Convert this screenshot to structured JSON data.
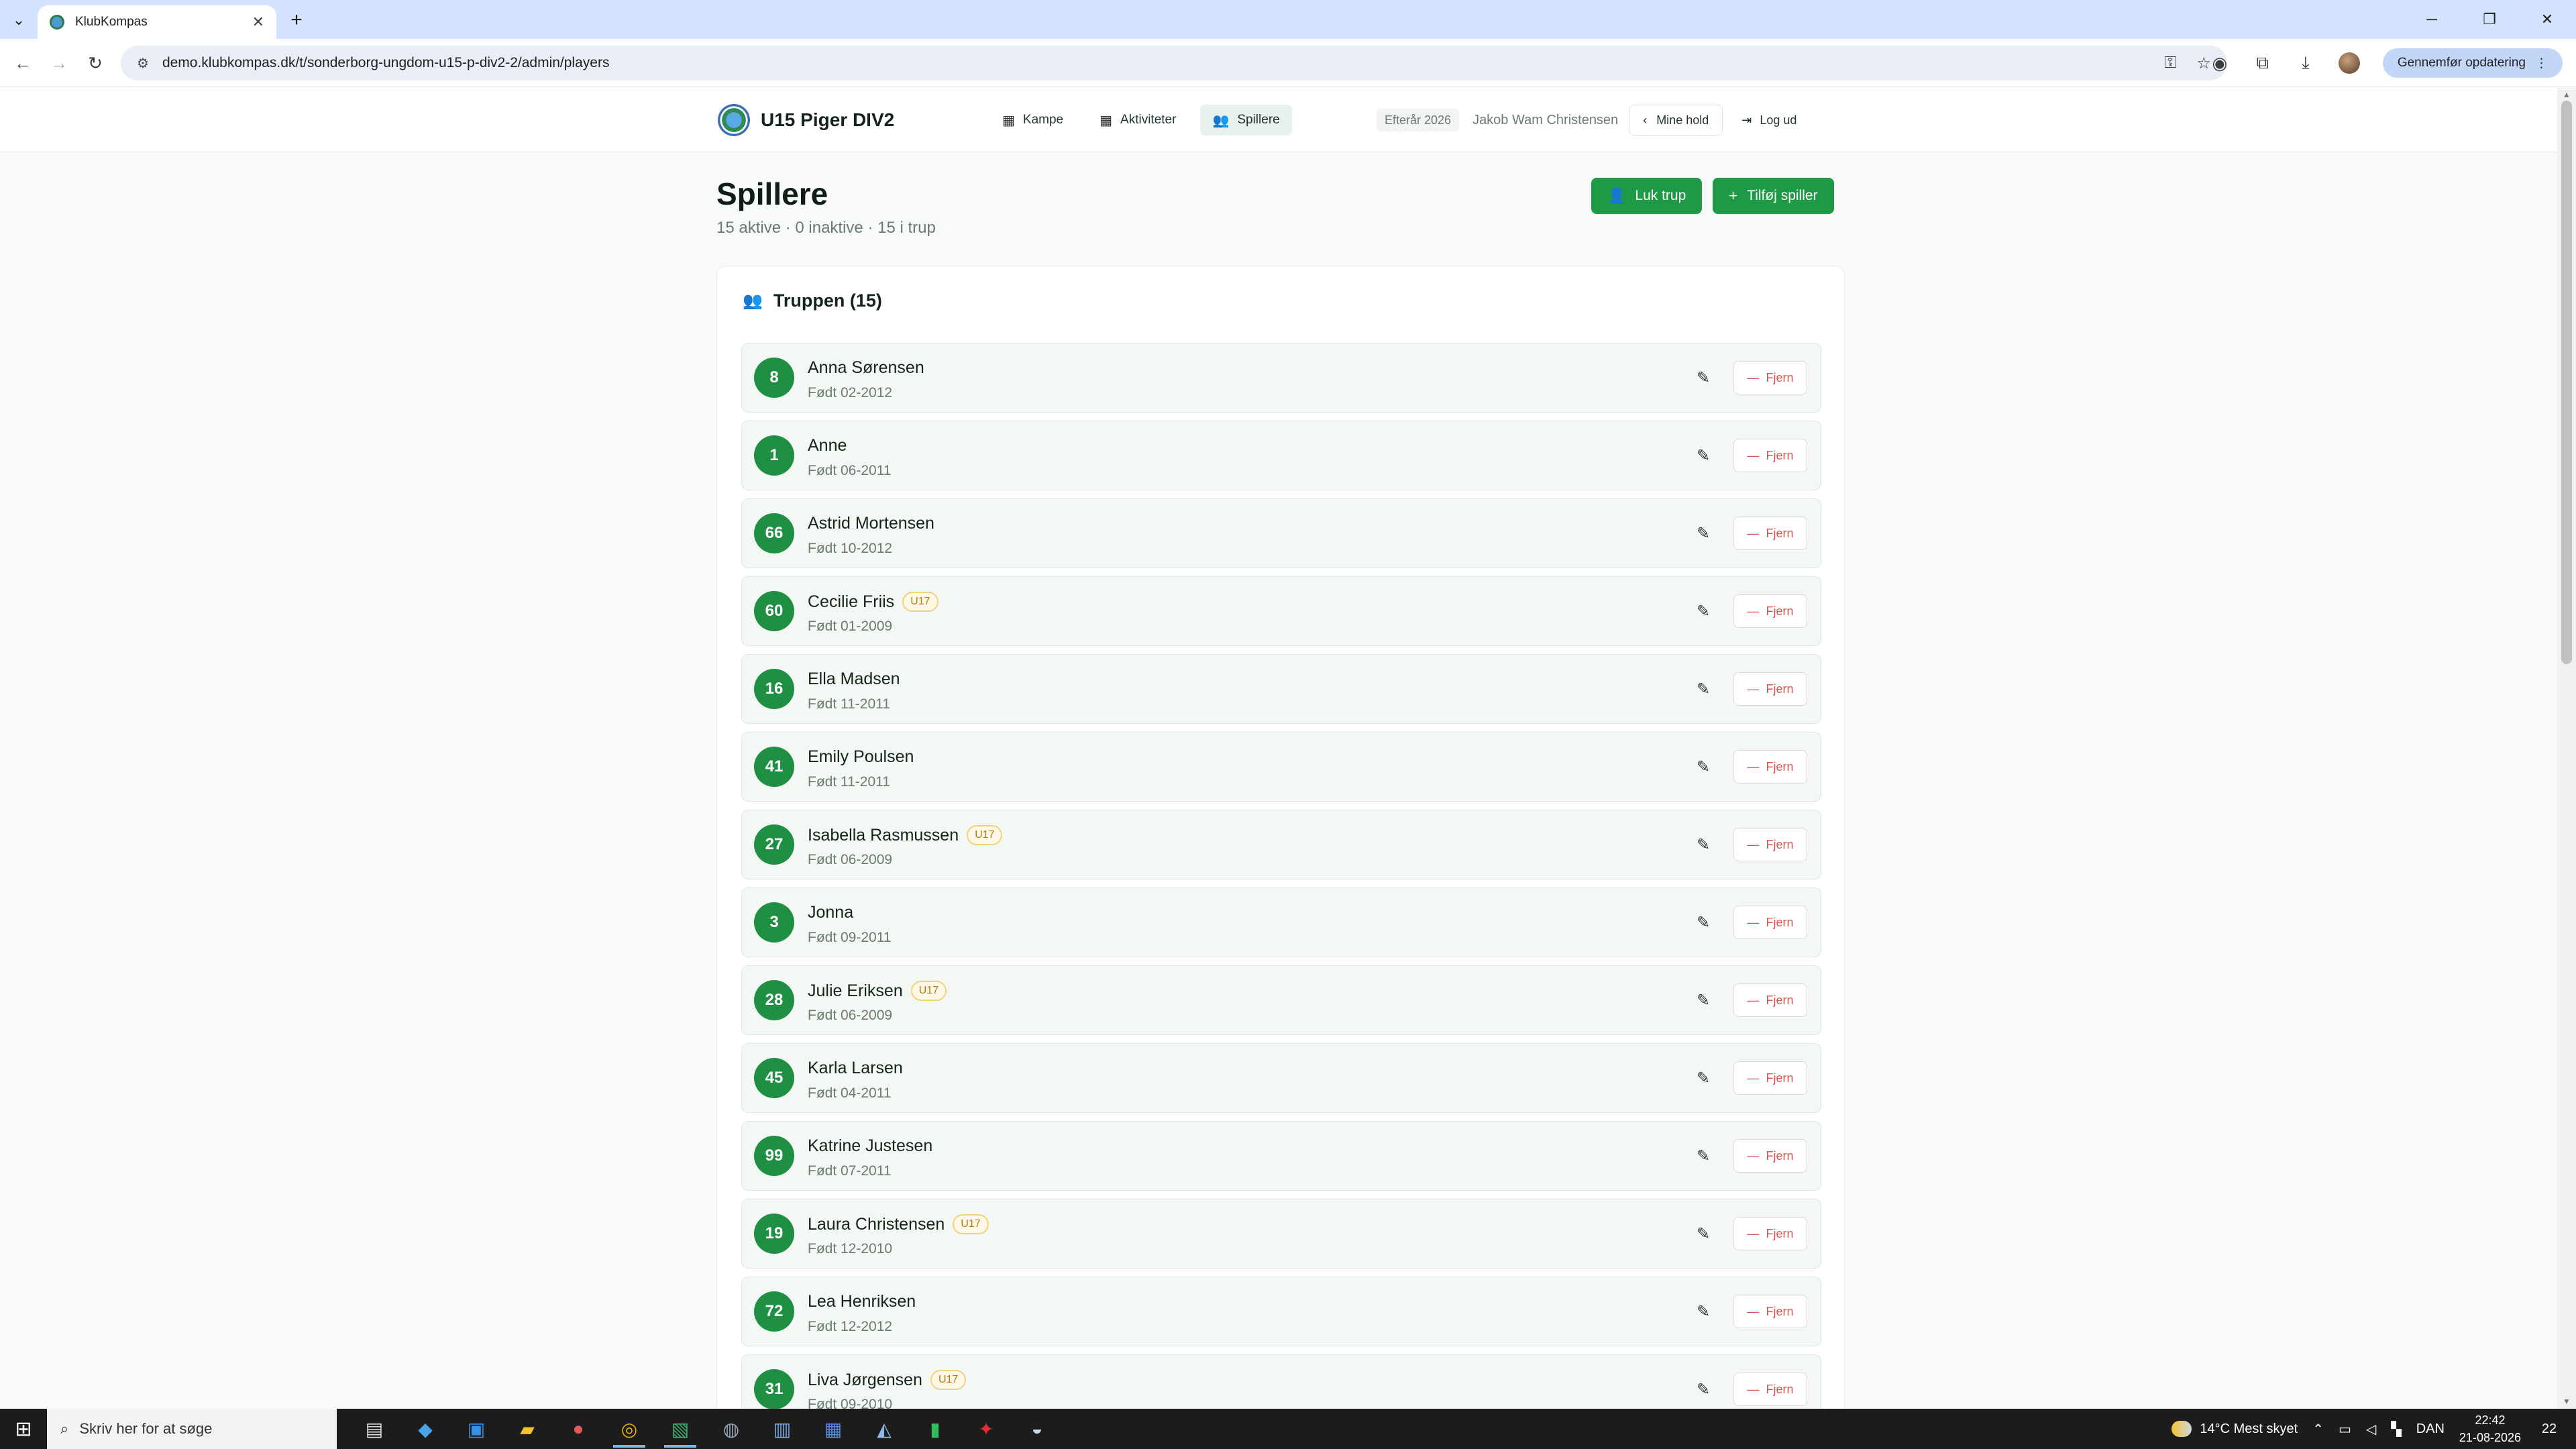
{
  "browser": {
    "tab_title": "KlubKompas",
    "url": "demo.klubkompas.dk/t/sonderborg-ungdom-u15-p-div2-2/admin/players",
    "update_label": "Gennemfør opdatering"
  },
  "header": {
    "team_name": "U15 Piger DIV2",
    "nav": [
      {
        "label": "Kampe",
        "icon": "calendar-icon"
      },
      {
        "label": "Aktiviteter",
        "icon": "calendar-icon"
      },
      {
        "label": "Spillere",
        "icon": "users-icon",
        "active": true
      }
    ],
    "season": "Efterår 2026",
    "user": "Jakob Wam Christensen",
    "mine_hold": "Mine hold",
    "logout": "Log ud"
  },
  "page": {
    "title": "Spillere",
    "subtitle": "15 aktive · 0 inaktive · 15 i trup",
    "close_squad_label": "Luk trup",
    "add_player_label": "Tilføj spiller",
    "card_title": "Truppen (15)",
    "remove_label": "Fjern"
  },
  "players": [
    {
      "number": "8",
      "name": "Anna Sørensen",
      "born": "Født 02-2012",
      "badge": ""
    },
    {
      "number": "1",
      "name": "Anne",
      "born": "Født 06-2011",
      "badge": ""
    },
    {
      "number": "66",
      "name": "Astrid Mortensen",
      "born": "Født 10-2012",
      "badge": ""
    },
    {
      "number": "60",
      "name": "Cecilie Friis",
      "born": "Født 01-2009",
      "badge": "U17"
    },
    {
      "number": "16",
      "name": "Ella Madsen",
      "born": "Født 11-2011",
      "badge": ""
    },
    {
      "number": "41",
      "name": "Emily Poulsen",
      "born": "Født 11-2011",
      "badge": ""
    },
    {
      "number": "27",
      "name": "Isabella Rasmussen",
      "born": "Født 06-2009",
      "badge": "U17"
    },
    {
      "number": "3",
      "name": "Jonna",
      "born": "Født 09-2011",
      "badge": ""
    },
    {
      "number": "28",
      "name": "Julie Eriksen",
      "born": "Født 06-2009",
      "badge": "U17"
    },
    {
      "number": "45",
      "name": "Karla Larsen",
      "born": "Født 04-2011",
      "badge": ""
    },
    {
      "number": "99",
      "name": "Katrine Justesen",
      "born": "Født 07-2011",
      "badge": ""
    },
    {
      "number": "19",
      "name": "Laura Christensen",
      "born": "Født 12-2010",
      "badge": "U17"
    },
    {
      "number": "72",
      "name": "Lea Henriksen",
      "born": "Født 12-2012",
      "badge": ""
    },
    {
      "number": "31",
      "name": "Liva Jørgensen",
      "born": "Født 09-2010",
      "badge": "U17"
    }
  ],
  "taskbar": {
    "search_placeholder": "Skriv her for at søge",
    "weather": "14°C  Mest skyet",
    "language": "DAN",
    "time": "22:42",
    "date": "21-08-2026",
    "notifications": "22"
  },
  "colors": {
    "accent_green": "#1e9a47",
    "number_green": "#1e8f43",
    "remove_red": "#d9534f",
    "badge_amber": "#b07a10"
  }
}
